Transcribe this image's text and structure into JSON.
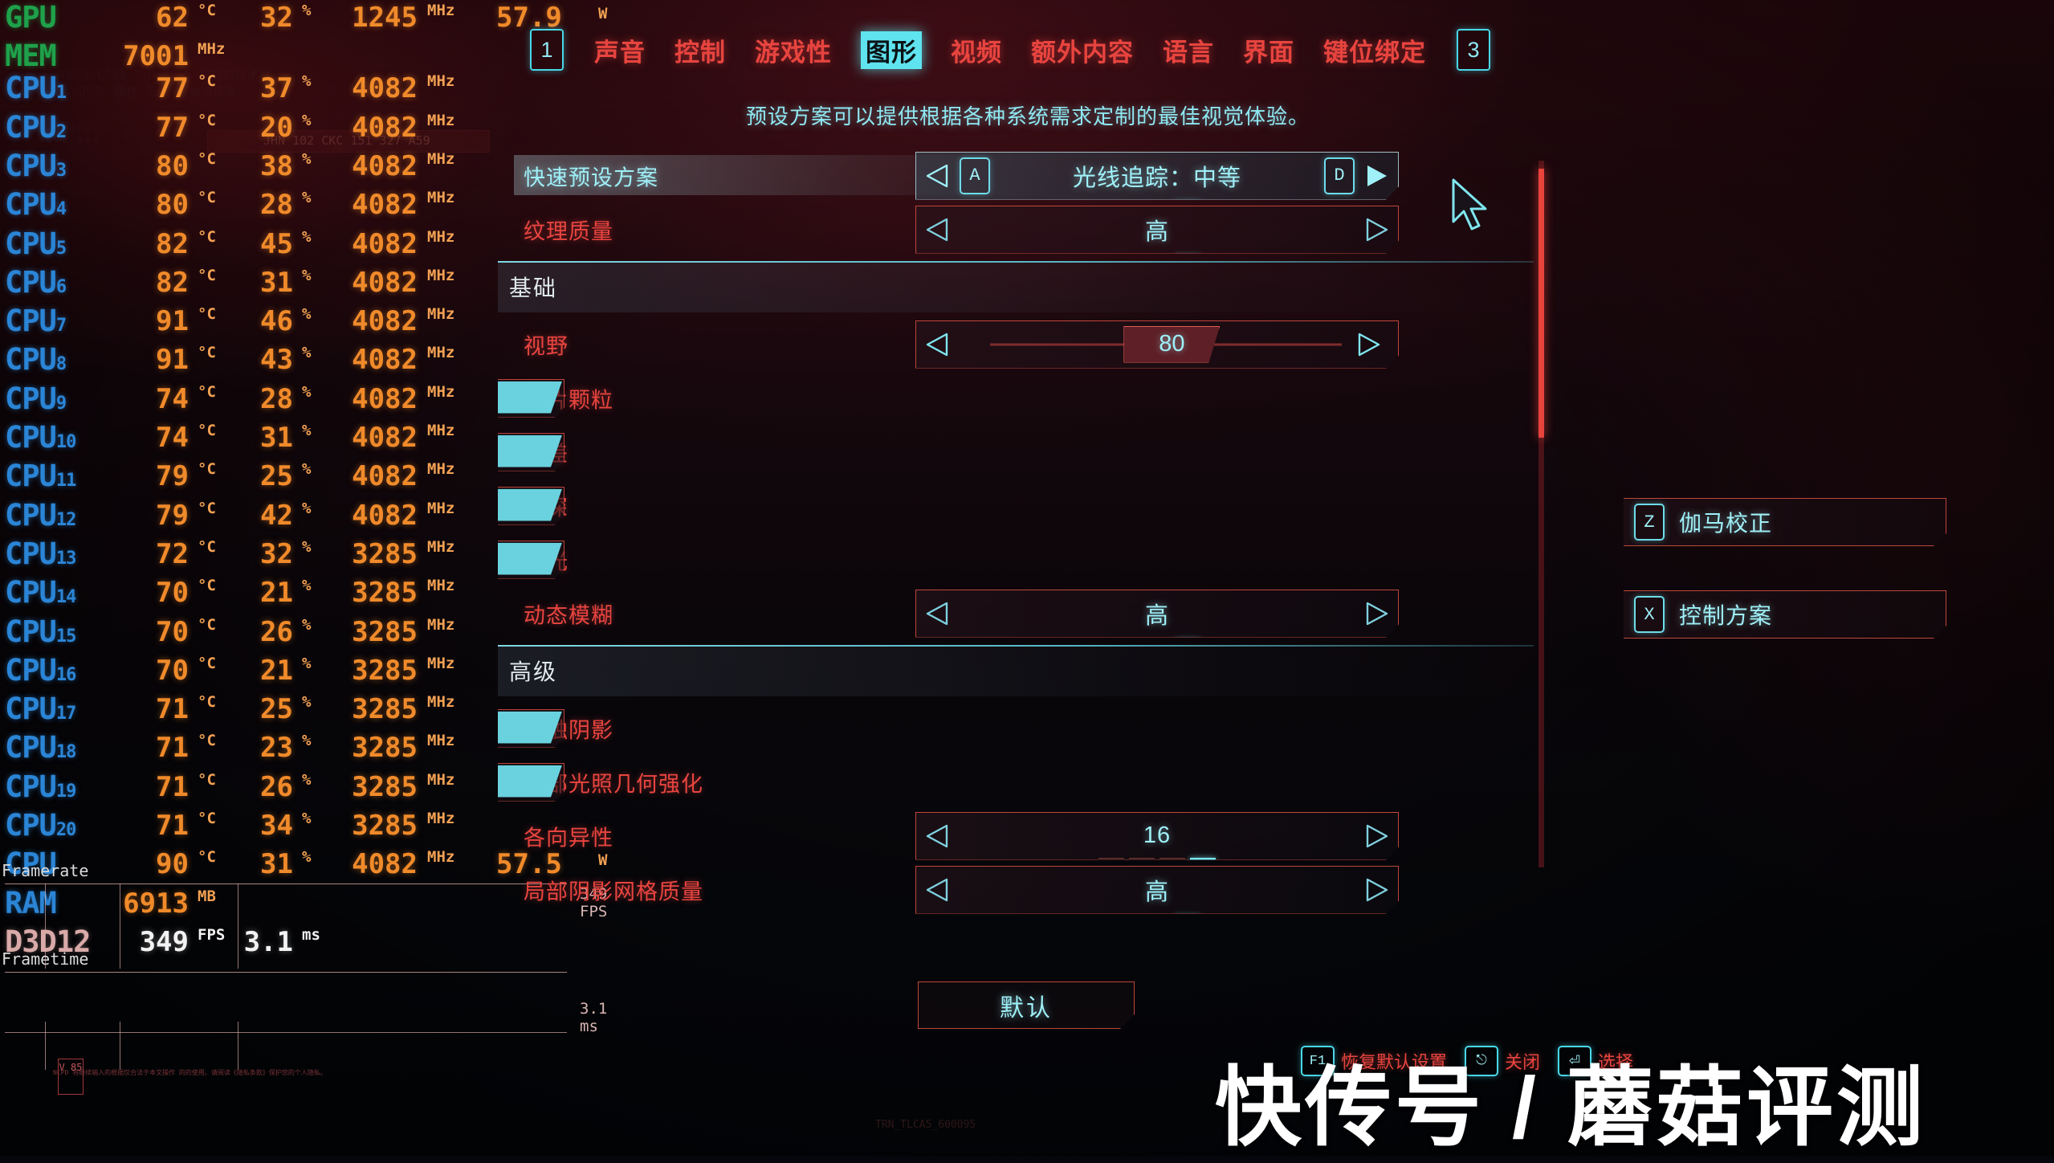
{
  "hud": {
    "rows": [
      {
        "label": "GPU",
        "sub": "",
        "labelColor": "green",
        "c1": "62",
        "u1": "°C",
        "c2": "32",
        "u2": "%",
        "c3": "1245",
        "u3": "MHz",
        "c4": "57.9",
        "u4": "W"
      },
      {
        "label": "MEM",
        "sub": "",
        "labelColor": "green",
        "c1": "7001",
        "u1": "MHz",
        "c2": "",
        "u2": "",
        "c3": "",
        "u3": "",
        "c4": "",
        "u4": ""
      },
      {
        "label": "CPU",
        "sub": "1",
        "labelColor": "blue",
        "c1": "77",
        "u1": "°C",
        "c2": "37",
        "u2": "%",
        "c3": "4082",
        "u3": "MHz",
        "c4": "",
        "u4": ""
      },
      {
        "label": "CPU",
        "sub": "2",
        "labelColor": "blue",
        "c1": "77",
        "u1": "°C",
        "c2": "20",
        "u2": "%",
        "c3": "4082",
        "u3": "MHz",
        "c4": "",
        "u4": ""
      },
      {
        "label": "CPU",
        "sub": "3",
        "labelColor": "blue",
        "c1": "80",
        "u1": "°C",
        "c2": "38",
        "u2": "%",
        "c3": "4082",
        "u3": "MHz",
        "c4": "",
        "u4": ""
      },
      {
        "label": "CPU",
        "sub": "4",
        "labelColor": "blue",
        "c1": "80",
        "u1": "°C",
        "c2": "28",
        "u2": "%",
        "c3": "4082",
        "u3": "MHz",
        "c4": "",
        "u4": ""
      },
      {
        "label": "CPU",
        "sub": "5",
        "labelColor": "blue",
        "c1": "82",
        "u1": "°C",
        "c2": "45",
        "u2": "%",
        "c3": "4082",
        "u3": "MHz",
        "c4": "",
        "u4": ""
      },
      {
        "label": "CPU",
        "sub": "6",
        "labelColor": "blue",
        "c1": "82",
        "u1": "°C",
        "c2": "31",
        "u2": "%",
        "c3": "4082",
        "u3": "MHz",
        "c4": "",
        "u4": ""
      },
      {
        "label": "CPU",
        "sub": "7",
        "labelColor": "blue",
        "c1": "91",
        "u1": "°C",
        "c2": "46",
        "u2": "%",
        "c3": "4082",
        "u3": "MHz",
        "c4": "",
        "u4": ""
      },
      {
        "label": "CPU",
        "sub": "8",
        "labelColor": "blue",
        "c1": "91",
        "u1": "°C",
        "c2": "43",
        "u2": "%",
        "c3": "4082",
        "u3": "MHz",
        "c4": "",
        "u4": ""
      },
      {
        "label": "CPU",
        "sub": "9",
        "labelColor": "blue",
        "c1": "74",
        "u1": "°C",
        "c2": "28",
        "u2": "%",
        "c3": "4082",
        "u3": "MHz",
        "c4": "",
        "u4": ""
      },
      {
        "label": "CPU",
        "sub": "10",
        "labelColor": "blue",
        "c1": "74",
        "u1": "°C",
        "c2": "31",
        "u2": "%",
        "c3": "4082",
        "u3": "MHz",
        "c4": "",
        "u4": ""
      },
      {
        "label": "CPU",
        "sub": "11",
        "labelColor": "blue",
        "c1": "79",
        "u1": "°C",
        "c2": "25",
        "u2": "%",
        "c3": "4082",
        "u3": "MHz",
        "c4": "",
        "u4": ""
      },
      {
        "label": "CPU",
        "sub": "12",
        "labelColor": "blue",
        "c1": "79",
        "u1": "°C",
        "c2": "42",
        "u2": "%",
        "c3": "4082",
        "u3": "MHz",
        "c4": "",
        "u4": ""
      },
      {
        "label": "CPU",
        "sub": "13",
        "labelColor": "blue",
        "c1": "72",
        "u1": "°C",
        "c2": "32",
        "u2": "%",
        "c3": "3285",
        "u3": "MHz",
        "c4": "",
        "u4": ""
      },
      {
        "label": "CPU",
        "sub": "14",
        "labelColor": "blue",
        "c1": "70",
        "u1": "°C",
        "c2": "21",
        "u2": "%",
        "c3": "3285",
        "u3": "MHz",
        "c4": "",
        "u4": ""
      },
      {
        "label": "CPU",
        "sub": "15",
        "labelColor": "blue",
        "c1": "70",
        "u1": "°C",
        "c2": "26",
        "u2": "%",
        "c3": "3285",
        "u3": "MHz",
        "c4": "",
        "u4": ""
      },
      {
        "label": "CPU",
        "sub": "16",
        "labelColor": "blue",
        "c1": "70",
        "u1": "°C",
        "c2": "21",
        "u2": "%",
        "c3": "3285",
        "u3": "MHz",
        "c4": "",
        "u4": ""
      },
      {
        "label": "CPU",
        "sub": "17",
        "labelColor": "blue",
        "c1": "71",
        "u1": "°C",
        "c2": "25",
        "u2": "%",
        "c3": "3285",
        "u3": "MHz",
        "c4": "",
        "u4": ""
      },
      {
        "label": "CPU",
        "sub": "18",
        "labelColor": "blue",
        "c1": "71",
        "u1": "°C",
        "c2": "23",
        "u2": "%",
        "c3": "3285",
        "u3": "MHz",
        "c4": "",
        "u4": ""
      },
      {
        "label": "CPU",
        "sub": "19",
        "labelColor": "blue",
        "c1": "71",
        "u1": "°C",
        "c2": "26",
        "u2": "%",
        "c3": "3285",
        "u3": "MHz",
        "c4": "",
        "u4": ""
      },
      {
        "label": "CPU",
        "sub": "20",
        "labelColor": "blue",
        "c1": "71",
        "u1": "°C",
        "c2": "34",
        "u2": "%",
        "c3": "3285",
        "u3": "MHz",
        "c4": "",
        "u4": ""
      },
      {
        "label": "CPU",
        "sub": "",
        "labelColor": "blue",
        "c1": "90",
        "u1": "°C",
        "c2": "31",
        "u2": "%",
        "c3": "4082",
        "u3": "MHz",
        "c4": "57.5",
        "u4": "W"
      },
      {
        "label": "RAM",
        "sub": "",
        "labelColor": "blue",
        "c1": "6913",
        "u1": "MB",
        "c2": "",
        "u2": "",
        "c3": "",
        "u3": "",
        "c4": "",
        "u4": ""
      },
      {
        "label": "D3D12",
        "sub": "",
        "labelColor": "d3d",
        "white": true,
        "c1": "349",
        "u1": "FPS",
        "c2": "3.1",
        "u2": "ms",
        "c3": "",
        "u3": "",
        "c4": "",
        "u4": ""
      }
    ],
    "graphs": [
      {
        "title": "Framerate",
        "value": "349 FPS"
      },
      {
        "title": "Frametime",
        "value": "3.1 ms"
      }
    ],
    "legal": "NCPD 将继续输入的根据仅合法于本文操作 的的使用。请阅读《隐私条款》保护您的个人隐私。",
    "vbadge": "V 85"
  },
  "nav": {
    "left_key": "1",
    "right_key": "3",
    "items": [
      {
        "label": "声音",
        "active": false
      },
      {
        "label": "控制",
        "active": false
      },
      {
        "label": "游戏性",
        "active": false
      },
      {
        "label": "图形",
        "active": true
      },
      {
        "label": "视频",
        "active": false
      },
      {
        "label": "额外内容",
        "active": false
      },
      {
        "label": "语言",
        "active": false
      },
      {
        "label": "界面",
        "active": false
      },
      {
        "label": "键位绑定",
        "active": false
      }
    ]
  },
  "subtitle": "预设方案可以提供根据各种系统需求定制的最佳视觉体验。",
  "settings": [
    {
      "kind": "stepper",
      "label": "快速预设方案",
      "value": "光线追踪：中等",
      "selected": true,
      "left_key": "A",
      "right_key": "D",
      "ticks": {
        "count": 3,
        "active": 2
      },
      "right_arrow_filled": true
    },
    {
      "kind": "stepper",
      "label": "纹理质量",
      "value": "高",
      "selected": false,
      "ticks": {
        "count": 3,
        "active": 2
      },
      "right_arrow_filled": false
    },
    {
      "kind": "section",
      "label": "基础"
    },
    {
      "kind": "slider",
      "label": "视野",
      "value": "80",
      "fill_pct": 52
    },
    {
      "kind": "toggle",
      "label": "胶片颗粒",
      "state": "开",
      "on": true
    },
    {
      "kind": "toggle",
      "label": "色差",
      "state": "开",
      "on": true
    },
    {
      "kind": "toggle",
      "label": "景深",
      "state": "开",
      "on": true
    },
    {
      "kind": "toggle",
      "label": "眩光",
      "state": "开",
      "on": true
    },
    {
      "kind": "stepper",
      "label": "动态模糊",
      "value": "高",
      "selected": false,
      "ticks": {
        "count": 3,
        "active": 2
      },
      "right_arrow_filled": false
    },
    {
      "kind": "section",
      "label": "高级"
    },
    {
      "kind": "toggle",
      "label": "接触阴影",
      "state": "开",
      "on": true
    },
    {
      "kind": "toggle",
      "label": "面部光照几何强化",
      "state": "开",
      "on": true
    },
    {
      "kind": "stepper",
      "label": "各向异性",
      "value": "16",
      "selected": false,
      "ticks": {
        "count": 4,
        "active": 3
      },
      "right_arrow_filled": false
    },
    {
      "kind": "stepper",
      "label": "局部阴影网格质量",
      "value": "高",
      "selected": false,
      "ticks": {
        "count": 3,
        "active": 2
      },
      "right_arrow_filled": false
    }
  ],
  "side_actions": [
    {
      "key": "Z",
      "label": "伽马校正"
    },
    {
      "key": "X",
      "label": "控制方案"
    }
  ],
  "default_button": "默认",
  "hints": [
    {
      "key": "F1",
      "label": "恢复默认设置"
    },
    {
      "key": "⎋",
      "label": "关闭"
    },
    {
      "key": "⏎",
      "label": "选择"
    }
  ],
  "watermark": "快传号 / 蘑菇评测",
  "colors": {
    "accent_red": "#e8443f",
    "accent_cyan": "#9ff0f8",
    "toggle_on": "#6ad2de",
    "hud_orange": "#f08a2a",
    "hud_blue": "#2b85d6",
    "hud_green": "#1ea14a",
    "scrollbar": "#e8433c"
  }
}
